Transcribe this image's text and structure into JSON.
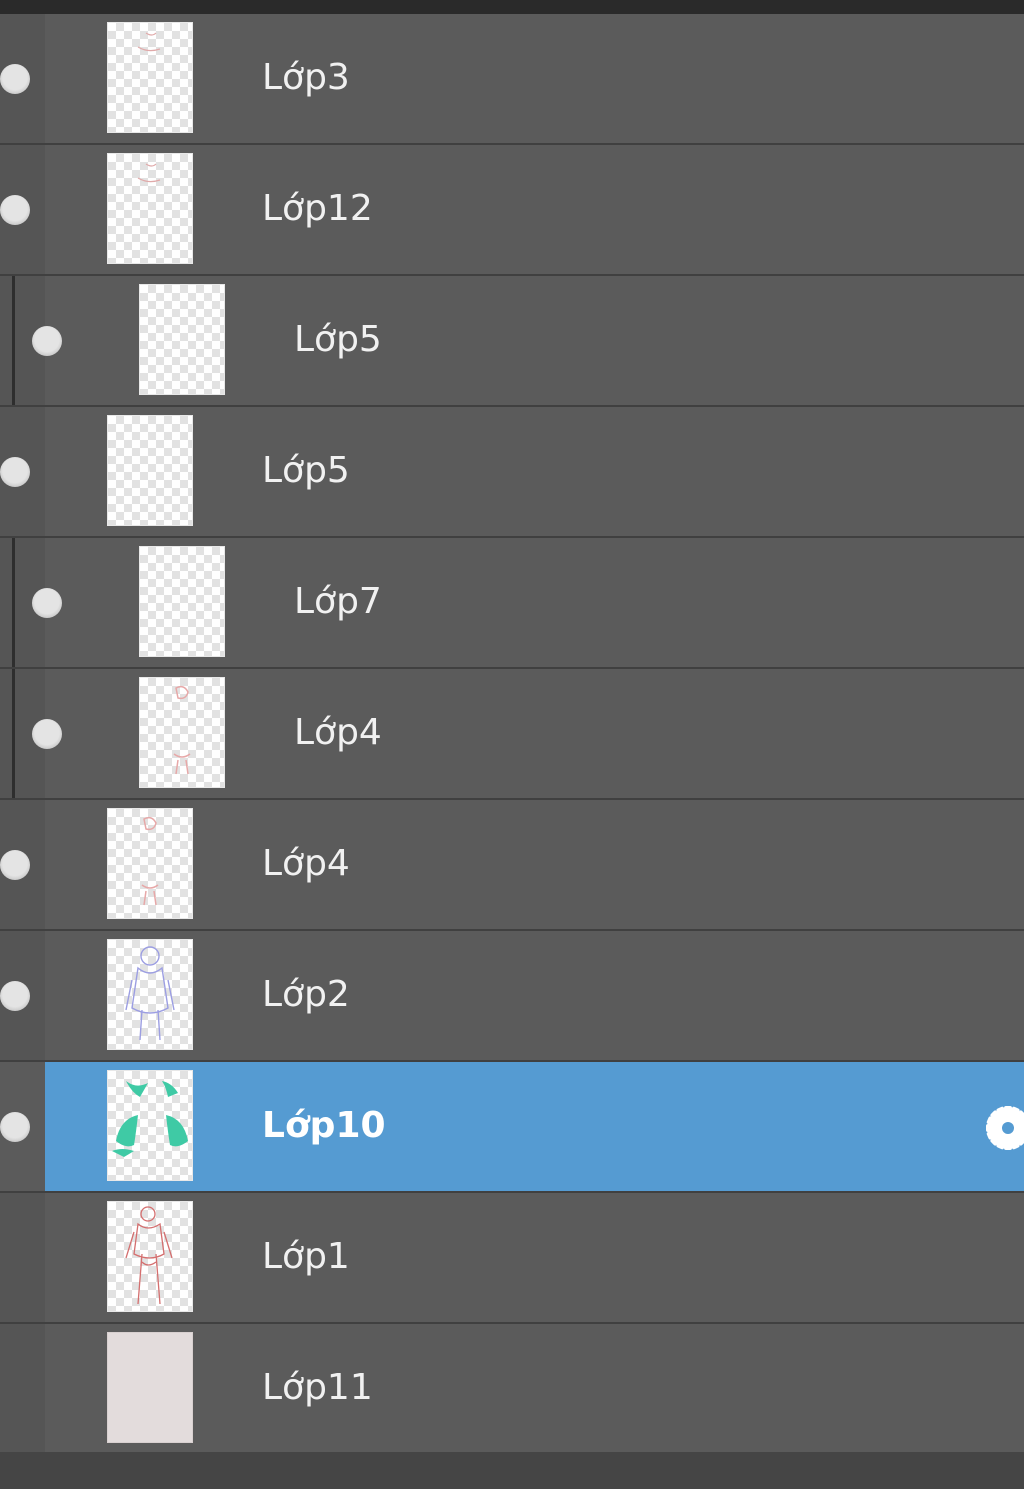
{
  "panel_title": "",
  "layers": [
    {
      "name": "Lớp3",
      "visible": true,
      "indented": false,
      "selected": false,
      "thumb": "sketch-faint"
    },
    {
      "name": "Lớp12",
      "visible": true,
      "indented": false,
      "selected": false,
      "thumb": "sketch-faint"
    },
    {
      "name": "Lớp5",
      "visible": true,
      "indented": true,
      "selected": false,
      "thumb": "blank"
    },
    {
      "name": "Lớp5",
      "visible": true,
      "indented": false,
      "selected": false,
      "thumb": "blank"
    },
    {
      "name": "Lớp7",
      "visible": true,
      "indented": true,
      "selected": false,
      "thumb": "blank"
    },
    {
      "name": "Lớp4",
      "visible": true,
      "indented": true,
      "selected": false,
      "thumb": "sketch-pink"
    },
    {
      "name": "Lớp4",
      "visible": true,
      "indented": false,
      "selected": false,
      "thumb": "sketch-pink"
    },
    {
      "name": "Lớp2",
      "visible": true,
      "indented": false,
      "selected": false,
      "thumb": "sketch-blue"
    },
    {
      "name": "Lớp10",
      "visible": true,
      "indented": false,
      "selected": true,
      "thumb": "teal-shape"
    },
    {
      "name": "Lớp1",
      "visible": false,
      "indented": false,
      "selected": false,
      "thumb": "sketch-red"
    },
    {
      "name": "Lớp11",
      "visible": false,
      "indented": false,
      "selected": false,
      "thumb": "solid-fill"
    }
  ],
  "colors": {
    "selected": "#559bd2",
    "row": "#5b5b5b",
    "separator": "#404040",
    "text": "#f1f1f1",
    "fill_layer": "#e3dcdc"
  },
  "icons": {
    "visibility": "eye-dot-icon",
    "settings": "gear-icon"
  }
}
